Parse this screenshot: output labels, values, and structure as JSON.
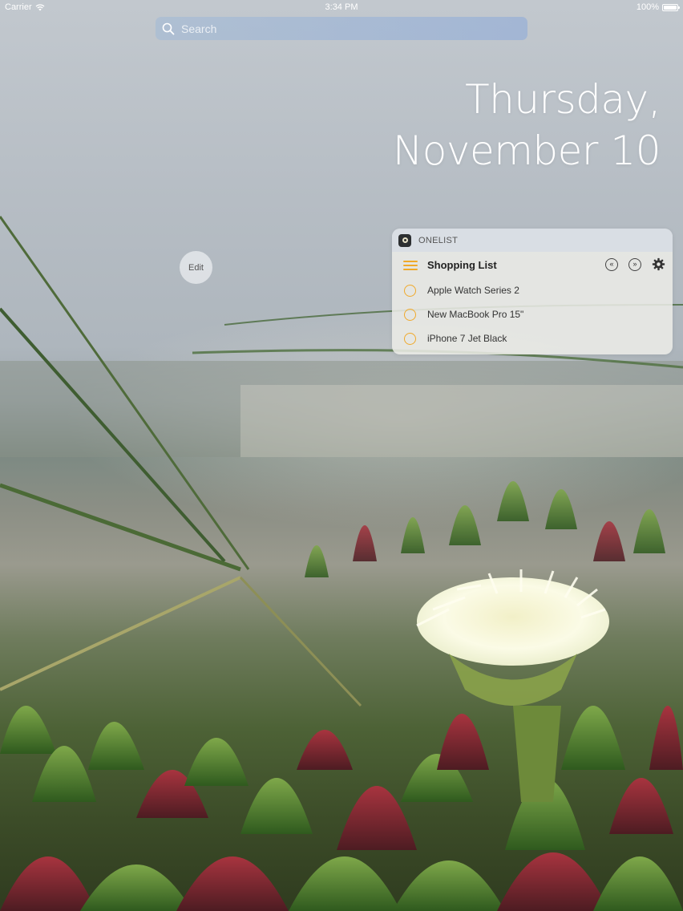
{
  "status_bar": {
    "carrier": "Carrier",
    "time": "3:34 PM",
    "battery": "100%",
    "battery_level": 1.0
  },
  "search": {
    "placeholder": "Search",
    "value": ""
  },
  "date": {
    "weekday": "Thursday,",
    "month_day": "November 10"
  },
  "edit_button": {
    "label": "Edit"
  },
  "widget": {
    "app_name": "ONELIST",
    "list_title": "Shopping List",
    "items": [
      {
        "label": "Apple Watch Series 2",
        "done": false
      },
      {
        "label": "New MacBook Pro 15\"",
        "done": false
      },
      {
        "label": "iPhone 7 Jet Black",
        "done": false
      }
    ],
    "prev_symbol": "«",
    "next_symbol": "»"
  },
  "colors": {
    "accent": "#f0a92a",
    "text": "#ffffff"
  },
  "icons": {
    "wifi": "wifi-icon",
    "battery": "battery-icon",
    "search": "search-icon",
    "app": "onelist-app-icon",
    "list": "hamburger-icon",
    "previous": "rewind-icon",
    "next": "fast-forward-icon",
    "settings": "gear-icon",
    "checkbox": "circle-checkbox-icon"
  }
}
